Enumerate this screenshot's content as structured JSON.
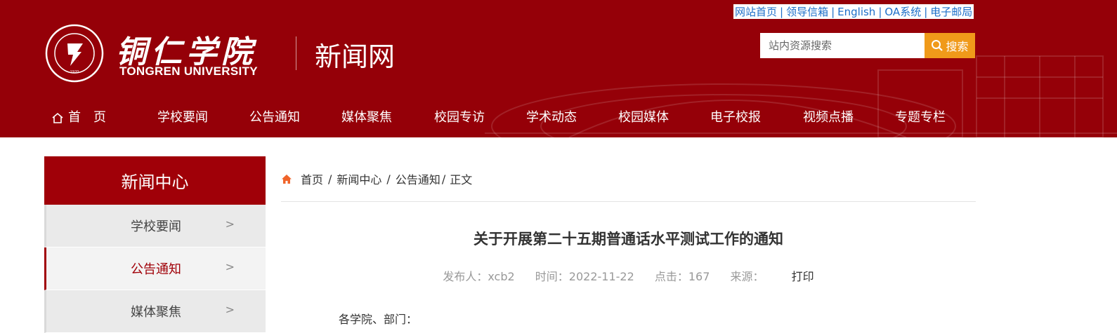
{
  "header": {
    "top_links": [
      "网站首页",
      "领导信箱",
      "English",
      "OA系统",
      "电子邮局"
    ],
    "link_separator": "|",
    "logo_cn": "铜仁学院",
    "logo_en": "TONGREN UNIVERSITY",
    "seal_year": "1920",
    "site_name": "新闻网",
    "search": {
      "placeholder": "站内资源搜索",
      "button_label": "搜索"
    },
    "nav": [
      "首　页",
      "学校要闻",
      "公告通知",
      "媒体聚焦",
      "校园专访",
      "学术动态",
      "校园媒体",
      "电子校报",
      "视频点播",
      "专题专栏"
    ]
  },
  "sidebar": {
    "title": "新闻中心",
    "items": [
      {
        "label": "学校要闻",
        "active": false
      },
      {
        "label": "公告通知",
        "active": true
      },
      {
        "label": "媒体聚焦",
        "active": false
      }
    ]
  },
  "breadcrumb": {
    "home": "首页",
    "level1": "新闻中心",
    "level2": "公告通知",
    "current": "正文"
  },
  "article": {
    "title": "关于开展第二十五期普通话水平测试工作的通知",
    "publisher": "发布人：xcb2",
    "time": "时间：2022-11-22",
    "clicks": "点击：167",
    "source": "来源：",
    "print_label": "打印",
    "body_start": "各学院、部门："
  },
  "colors": {
    "brand_red": "#950008",
    "accent_orange": "#f09a1a",
    "link_blue": "#1d6fc9"
  }
}
